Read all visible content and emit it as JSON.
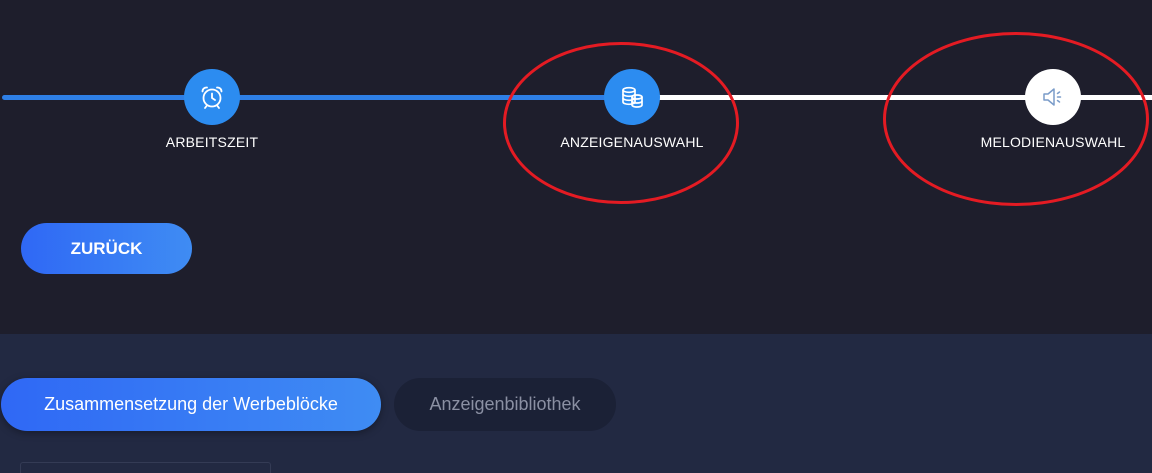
{
  "stepper": {
    "steps": [
      {
        "label": "ARBEITSZEIT",
        "icon": "alarm-clock-icon",
        "state": "completed"
      },
      {
        "label": "ANZEIGENAUSWAHL",
        "icon": "coins-stack-icon",
        "state": "current"
      },
      {
        "label": "MELODIENAUSWAHL",
        "icon": "speaker-icon",
        "state": "upcoming"
      }
    ]
  },
  "actions": {
    "back_label": "ZURÜCK"
  },
  "tabs": [
    {
      "label": "Zusammensetzung der Werbeblöcke",
      "active": true
    },
    {
      "label": "Anzeigenbibliothek",
      "active": false
    }
  ],
  "colors": {
    "accent": "#2c8cf0",
    "background_top": "#1e1e2c",
    "background_bottom": "#222942",
    "annotation": "#e41b23"
  }
}
